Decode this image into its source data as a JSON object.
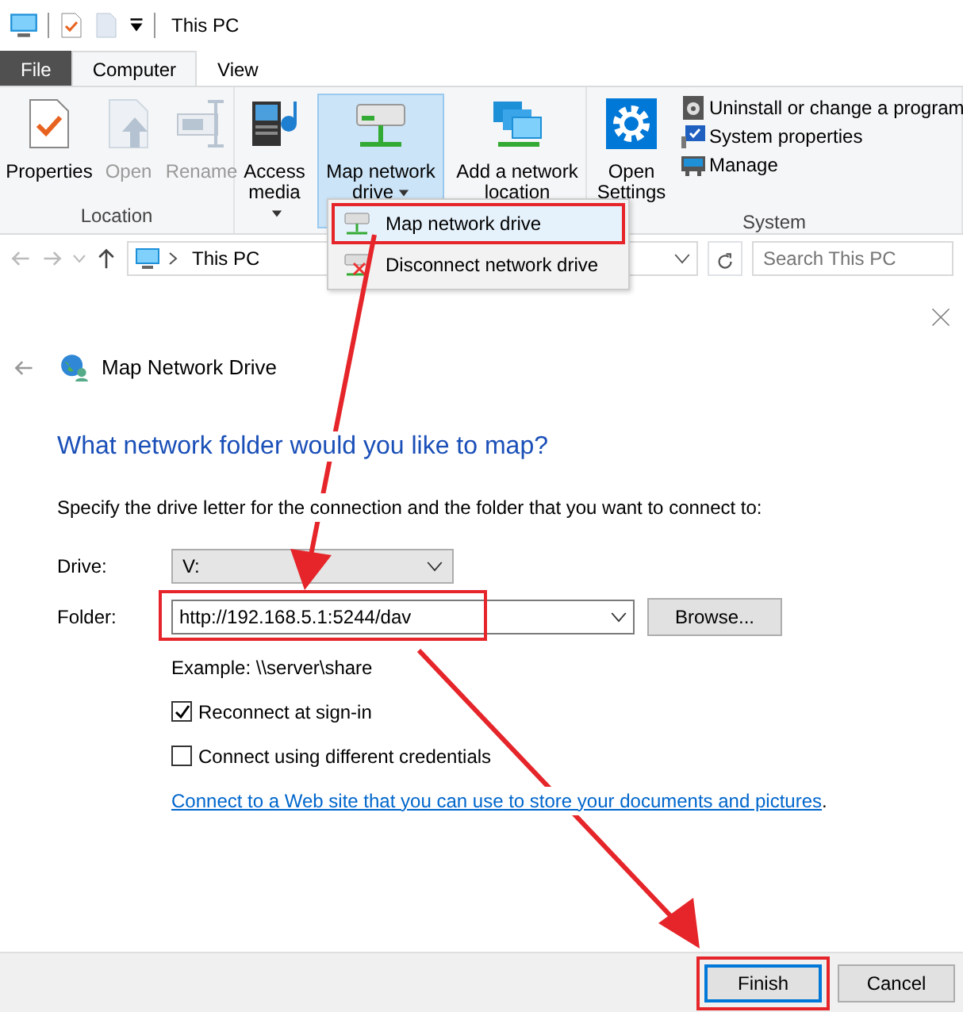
{
  "window": {
    "title": "This PC"
  },
  "ribbon_tabs": [
    {
      "label": "File",
      "kind": "file",
      "selected": false
    },
    {
      "label": "Computer",
      "kind": "tab",
      "selected": true
    },
    {
      "label": "View",
      "kind": "tab",
      "selected": false
    }
  ],
  "ribbon_groups": [
    {
      "label": "Location",
      "commands": [
        {
          "label": "Properties",
          "disabled": false,
          "dropdown": false,
          "selected": false
        },
        {
          "label": "Open",
          "disabled": true,
          "dropdown": false,
          "selected": false
        },
        {
          "label": "Rename",
          "disabled": true,
          "dropdown": false,
          "selected": false
        }
      ]
    },
    {
      "commands": [
        {
          "label": "Access media",
          "disabled": false,
          "dropdown": true,
          "selected": false
        },
        {
          "label": "Map network drive",
          "disabled": false,
          "dropdown": true,
          "selected": true
        },
        {
          "label": "Add a network location",
          "disabled": false,
          "dropdown": false,
          "selected": false
        }
      ]
    },
    {
      "label": "System",
      "commands": [
        {
          "label": "Open Settings",
          "disabled": false,
          "dropdown": false,
          "selected": false
        }
      ],
      "small_commands": [
        {
          "label": "Uninstall or change a program"
        },
        {
          "label": "System properties"
        },
        {
          "label": "Manage"
        }
      ]
    }
  ],
  "dropdown_menu": [
    {
      "label": "Map network drive",
      "highlighted": true
    },
    {
      "label": "Disconnect network drive",
      "highlighted": false
    }
  ],
  "address_bar": {
    "path": "This PC",
    "search_placeholder": "Search This PC"
  },
  "dialog": {
    "title": "Map Network Drive",
    "heading": "What network folder would you like to map?",
    "instruction": "Specify the drive letter for the connection and the folder that you want to connect to:",
    "drive_label": "Drive:",
    "drive_value": "V:",
    "folder_label": "Folder:",
    "folder_value": "http://192.168.5.1:5244/dav",
    "folder_highlighted": true,
    "browse_button": "Browse...",
    "example": "Example: \\\\server\\share",
    "checkboxes": [
      {
        "label": "Reconnect at sign-in",
        "checked": true
      },
      {
        "label": "Connect using different credentials",
        "checked": false
      }
    ],
    "link": "Connect to a Web site that you can use to store your documents and pictures",
    "link_suffix": ".",
    "buttons": [
      {
        "label": "Finish",
        "default": true,
        "highlighted": true
      },
      {
        "label": "Cancel",
        "default": false,
        "highlighted": false
      }
    ]
  }
}
